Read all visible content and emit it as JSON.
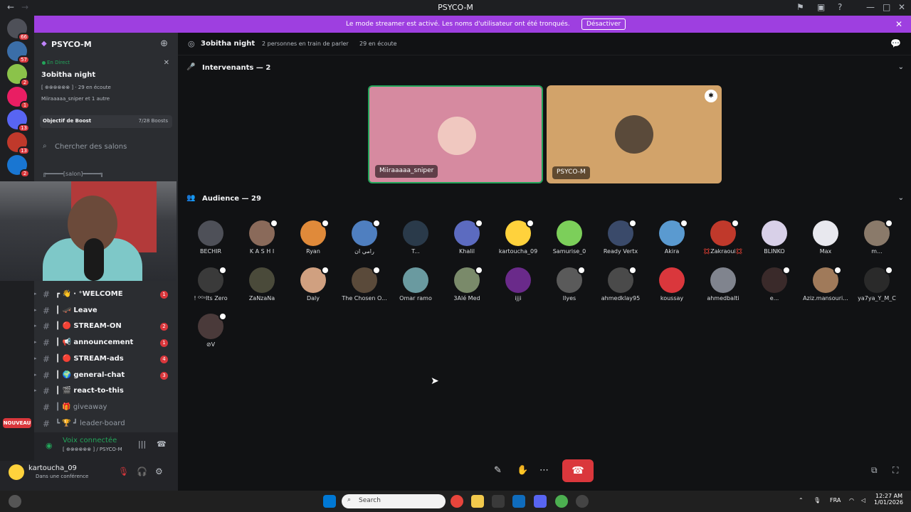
{
  "window": {
    "title": "PSYCO-M"
  },
  "banner": {
    "message": "Le mode streamer est activé. Les noms d'utilisateur ont été tronqués.",
    "button": "Désactiver"
  },
  "servers": [
    {
      "badge": "66",
      "color": "#4e5058"
    },
    {
      "badge": "57",
      "color": "#3b6ea8"
    },
    {
      "badge": "2",
      "color": "#8bc34a"
    },
    {
      "badge": "1",
      "color": "#e91e63"
    },
    {
      "badge": "13",
      "color": "#5865f2"
    },
    {
      "badge": "13",
      "color": "#c0392b"
    },
    {
      "badge": "2",
      "color": "#1976d2"
    }
  ],
  "new_label": "NOUVEAU",
  "guild": {
    "name": "PSYCO-M",
    "live_label": "En Direct",
    "stage_title": "3obitha night",
    "stage_meta": "[ ⊕⊗⊗⊗⊗⊗ ]  ·  29 en écoute",
    "stage_users": "Miiraaaaa_sniper et 1 autre",
    "boost_label": "Objectif de Boost",
    "boost_count": "7/28 Boosts",
    "search_placeholder": "Chercher des salons",
    "category": "╔━━━━━[salon]━━━━━╗"
  },
  "channels": [
    {
      "label": "┏ 👋 ‧ ⁺WELCOME",
      "unread": "1",
      "muted": false
    },
    {
      "label": "┃ 🛹 Leave",
      "unread": "",
      "muted": false
    },
    {
      "label": "┃ 🔴 STREAM-ON",
      "unread": "2",
      "muted": false
    },
    {
      "label": "┃ 📢 announcement",
      "unread": "1",
      "muted": false
    },
    {
      "label": "┃ 🔴 STREAM-ads",
      "unread": "4",
      "muted": false
    },
    {
      "label": "┃ 🌍 general-chat",
      "unread": "3",
      "muted": false
    },
    {
      "label": "┃ 🎬 react-to-this",
      "unread": "",
      "muted": false
    },
    {
      "label": "┃ 🎁 giveaway",
      "unread": "",
      "muted": true
    },
    {
      "label": "┗ 🏆 ┛ leader-board",
      "unread": "",
      "muted": true
    }
  ],
  "voice": {
    "status": "Voix connectée",
    "server": "[ ⊕⊗⊗⊗⊗⊗ ] / PSYCO-M"
  },
  "user": {
    "name": "kartoucha_09",
    "status": "Dans une conférence"
  },
  "stage": {
    "name": "3obitha night",
    "speaking": "2 personnes en train de parler",
    "listening": "29 en écoute",
    "speakers_header": "Intervenants — 2",
    "audience_header": "Audience — 29"
  },
  "speakers": [
    {
      "name": "Miiraaaaa_sniper",
      "bg": "#d68aa0",
      "avatar": "#f0c8c0"
    },
    {
      "name": "PSYCO-M",
      "bg": "#d2a36a",
      "avatar": "#5a4a3a"
    }
  ],
  "audience": [
    {
      "name": "BECHIR",
      "color": "#4e5058",
      "muted": false
    },
    {
      "name": "K A S H I",
      "color": "#8a6a5a",
      "muted": true
    },
    {
      "name": "Ryan",
      "color": "#e08a3a",
      "muted": true
    },
    {
      "name": "رامي ان",
      "color": "#4f7fc0",
      "muted": true
    },
    {
      "name": "T...",
      "color": "#2a3a4a",
      "muted": false
    },
    {
      "name": "Khalil",
      "color": "#5c6bc0",
      "muted": true
    },
    {
      "name": "kartoucha_09",
      "color": "#ffd23c",
      "muted": true
    },
    {
      "name": "Samurise_0",
      "color": "#7ccf5a",
      "muted": false
    },
    {
      "name": "Ready Vertx",
      "color": "#3a4a6a",
      "muted": true
    },
    {
      "name": "Akira",
      "color": "#5a9ad0",
      "muted": true
    },
    {
      "name": "💢Zakraoui💢",
      "color": "#c0392b",
      "muted": true
    },
    {
      "name": "BLINKO",
      "color": "#d8d0e8",
      "muted": false
    },
    {
      "name": "Max",
      "color": "#e8e8ee",
      "muted": false
    },
    {
      "name": "m...",
      "color": "#8a7a6a",
      "muted": true
    },
    {
      "name": "! ᴼᴳˢIts Zero",
      "color": "#3a3a3a",
      "muted": true
    },
    {
      "name": "ZaNzaNa",
      "color": "#4a4a3a",
      "muted": false
    },
    {
      "name": "Daly",
      "color": "#d0a080",
      "muted": true
    },
    {
      "name": "The Chosen O...",
      "color": "#5a4a3a",
      "muted": true
    },
    {
      "name": "Omar ramo",
      "color": "#6a9aa0",
      "muted": false
    },
    {
      "name": "3Alé Med",
      "color": "#7a8a6a",
      "muted": true
    },
    {
      "name": "ijji",
      "color": "#6a2a8a",
      "muted": false
    },
    {
      "name": "Ilyes",
      "color": "#5a5a5a",
      "muted": true
    },
    {
      "name": "ahmedklay95",
      "color": "#4a4a4a",
      "muted": true
    },
    {
      "name": "koussay",
      "color": "#da373c",
      "muted": false
    },
    {
      "name": "ahmedbalti",
      "color": "#80848e",
      "muted": false
    },
    {
      "name": "e...",
      "color": "#3a2a2a",
      "muted": true
    },
    {
      "name": "Aziz.mansouri...",
      "color": "#a07a5a",
      "muted": true
    },
    {
      "name": "ya7ya_Y_M_C",
      "color": "#2a2a2a",
      "muted": true
    },
    {
      "name": "⊘V",
      "color": "#4a3a3a",
      "muted": true
    }
  ],
  "taskbar": {
    "search": "Search",
    "lang": "FRA",
    "time": "12:27 AM",
    "date": "1/01/2026"
  }
}
